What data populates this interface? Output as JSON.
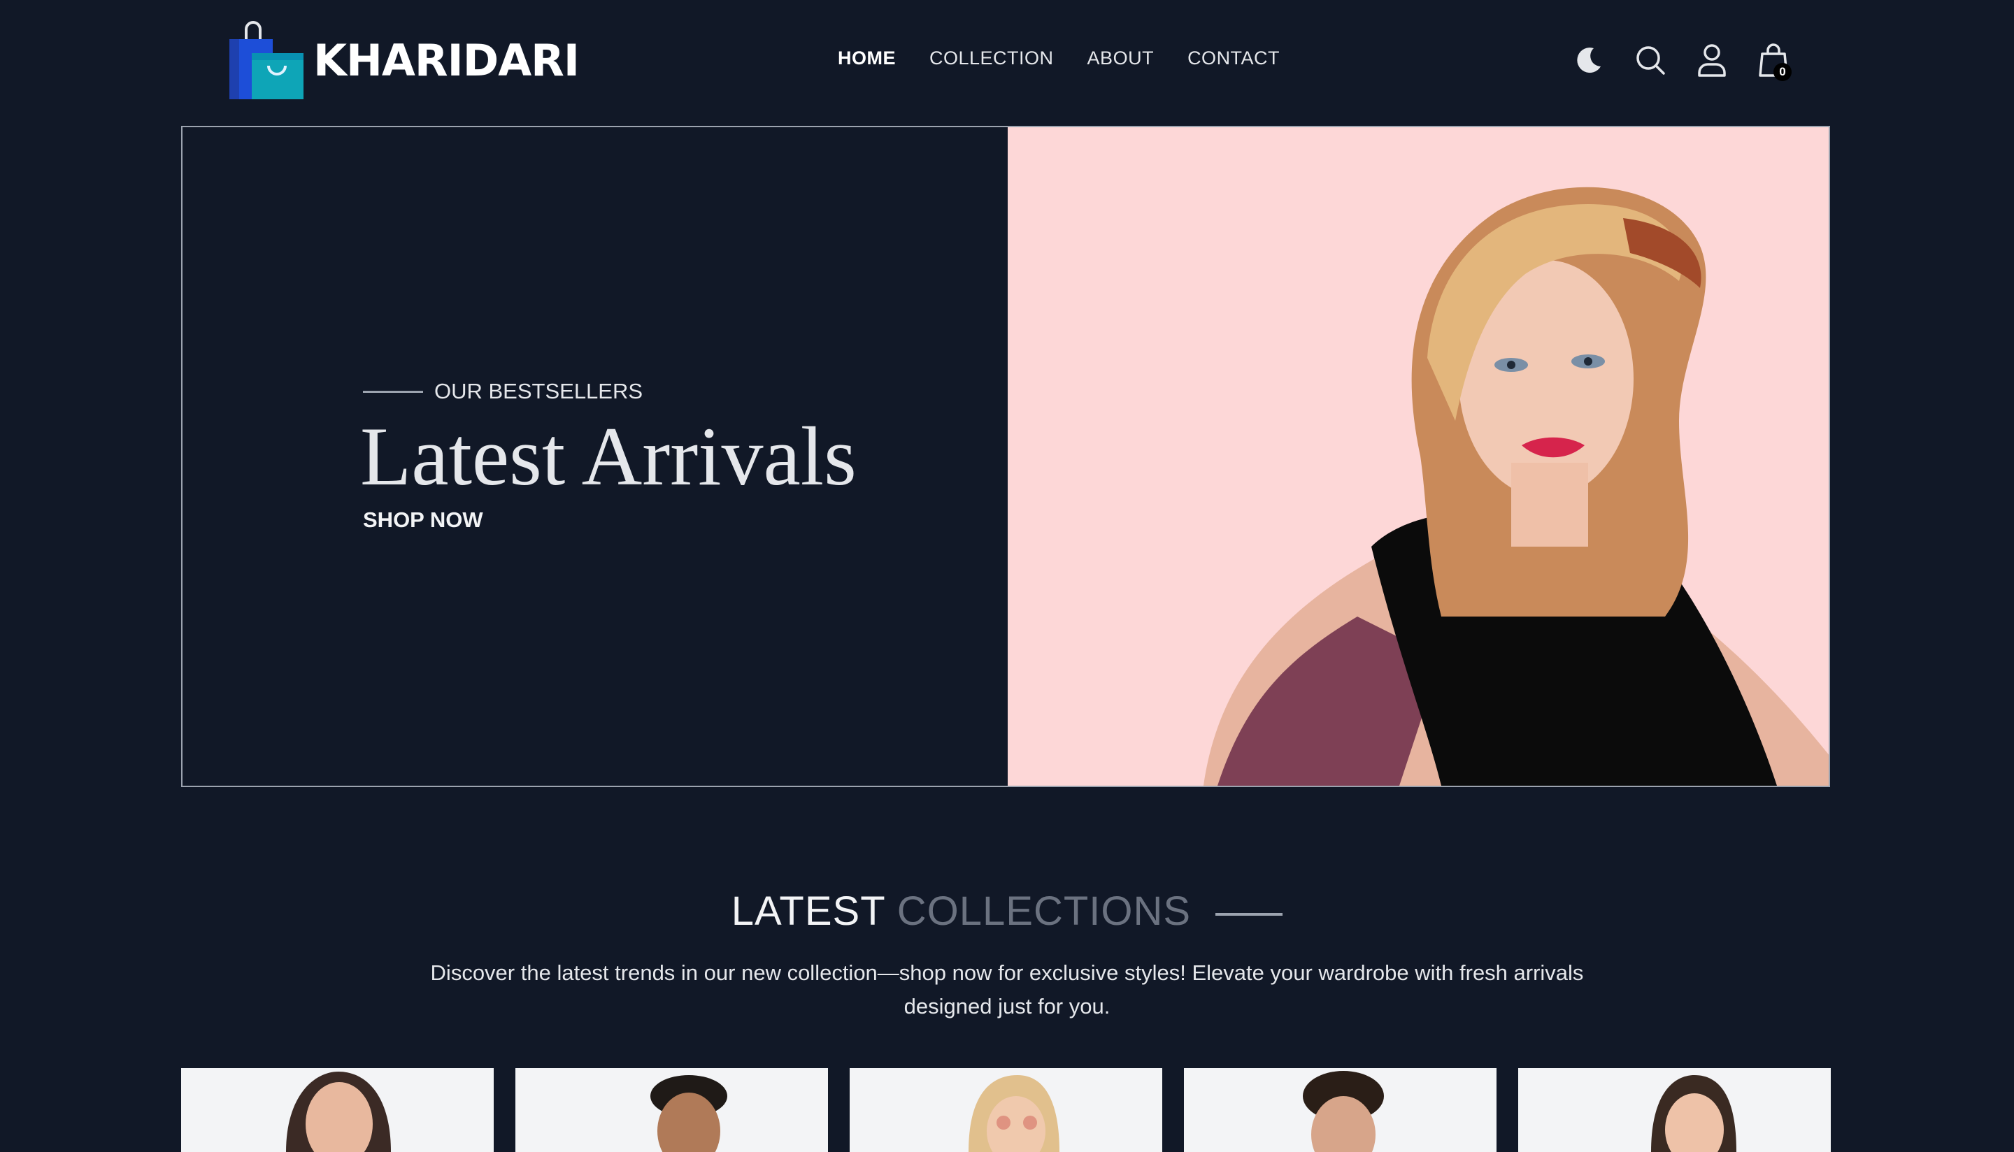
{
  "brand": {
    "name": "KHARIDARI",
    "logo_icon": "shopping-bag-icon"
  },
  "nav": {
    "items": [
      {
        "label": "HOME",
        "active": true
      },
      {
        "label": "COLLECTION",
        "active": false
      },
      {
        "label": "ABOUT",
        "active": false
      },
      {
        "label": "CONTACT",
        "active": false
      }
    ]
  },
  "header_icons": {
    "theme": "moon-icon",
    "search": "search-icon",
    "profile": "user-icon",
    "cart": "cart-icon",
    "cart_count": "0"
  },
  "hero": {
    "eyebrow": "OUR BESTSELLERS",
    "title": "Latest Arrivals",
    "cta": "SHOP NOW",
    "image_bg": "#fdd7d7"
  },
  "collections": {
    "title_part1": "LATEST",
    "title_part2": "COLLECTIONS",
    "description": "Discover the latest trends in our new collection—shop now for exclusive styles! Elevate your wardrobe with fresh arrivals designed just for you."
  },
  "colors": {
    "background": "#111827",
    "accent_muted": "#6b7280",
    "hero_pink": "#fdd7d7",
    "logo_blue": "#1d4ed8",
    "logo_teal": "#0ea5b7"
  }
}
